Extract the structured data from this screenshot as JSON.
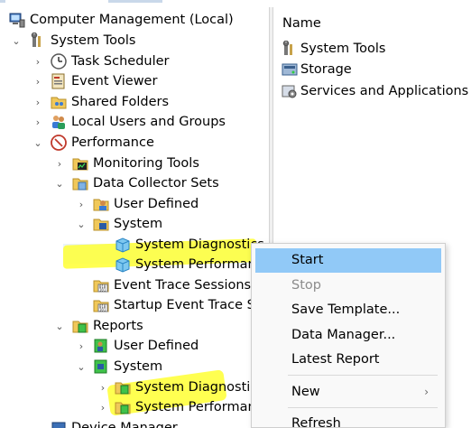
{
  "tree": {
    "items": [
      {
        "label": "Computer Management (Local)",
        "icon": "computer-management-icon",
        "arrow": ""
      },
      {
        "label": "System Tools",
        "icon": "system-tools-icon",
        "arrow": "expanded"
      },
      {
        "label": "Task Scheduler",
        "icon": "clock-icon",
        "arrow": "collapsed"
      },
      {
        "label": "Event Viewer",
        "icon": "event-viewer-icon",
        "arrow": "collapsed"
      },
      {
        "label": "Shared Folders",
        "icon": "shared-folder-icon",
        "arrow": "collapsed"
      },
      {
        "label": "Local Users and Groups",
        "icon": "users-icon",
        "arrow": "collapsed"
      },
      {
        "label": "Performance",
        "icon": "performance-icon",
        "arrow": "expanded"
      },
      {
        "label": "Monitoring Tools",
        "icon": "monitoring-folder-icon",
        "arrow": "collapsed"
      },
      {
        "label": "Data Collector Sets",
        "icon": "data-collector-folder-icon",
        "arrow": "expanded"
      },
      {
        "label": "User Defined",
        "icon": "user-defined-folder-icon",
        "arrow": "collapsed"
      },
      {
        "label": "System",
        "icon": "system-folder-icon",
        "arrow": "expanded"
      },
      {
        "label": "System Diagnostics",
        "icon": "collector-set-icon",
        "arrow": ""
      },
      {
        "label": "System Performance",
        "icon": "collector-set-icon",
        "arrow": ""
      },
      {
        "label": "Event Trace Sessions",
        "icon": "trace-folder-icon",
        "arrow": ""
      },
      {
        "label": "Startup Event Trace Sessions",
        "icon": "trace-folder-icon",
        "arrow": ""
      },
      {
        "label": "Reports",
        "icon": "reports-folder-icon",
        "arrow": "expanded"
      },
      {
        "label": "User Defined",
        "icon": "report-user-icon",
        "arrow": "collapsed"
      },
      {
        "label": "System",
        "icon": "report-system-icon",
        "arrow": "expanded"
      },
      {
        "label": "System Diagnostics",
        "icon": "report-folder-icon",
        "arrow": "collapsed"
      },
      {
        "label": "System Performance",
        "icon": "report-folder-icon",
        "arrow": "collapsed"
      },
      {
        "label": "Device Manager",
        "icon": "device-manager-icon",
        "arrow": ""
      }
    ]
  },
  "list": {
    "header": "Name",
    "items": [
      {
        "label": "System Tools",
        "icon": "system-tools-icon"
      },
      {
        "label": "Storage",
        "icon": "storage-icon"
      },
      {
        "label": "Services and Applications",
        "icon": "services-icon"
      }
    ]
  },
  "context_menu": {
    "items": [
      {
        "label": "Start",
        "state": "active"
      },
      {
        "label": "Stop",
        "state": "disabled"
      },
      {
        "label": "Save Template...",
        "state": "enabled"
      },
      {
        "label": "Data Manager...",
        "state": "enabled"
      },
      {
        "label": "Latest Report",
        "state": "enabled"
      },
      {
        "label": "New",
        "state": "enabled",
        "submenu": "›"
      },
      {
        "label": "Refresh",
        "state": "enabled"
      }
    ]
  },
  "colors": {
    "menu_highlight": "#91c9f7",
    "annotation_highlight": "#ffff33",
    "selection": "#eaf3fb"
  }
}
